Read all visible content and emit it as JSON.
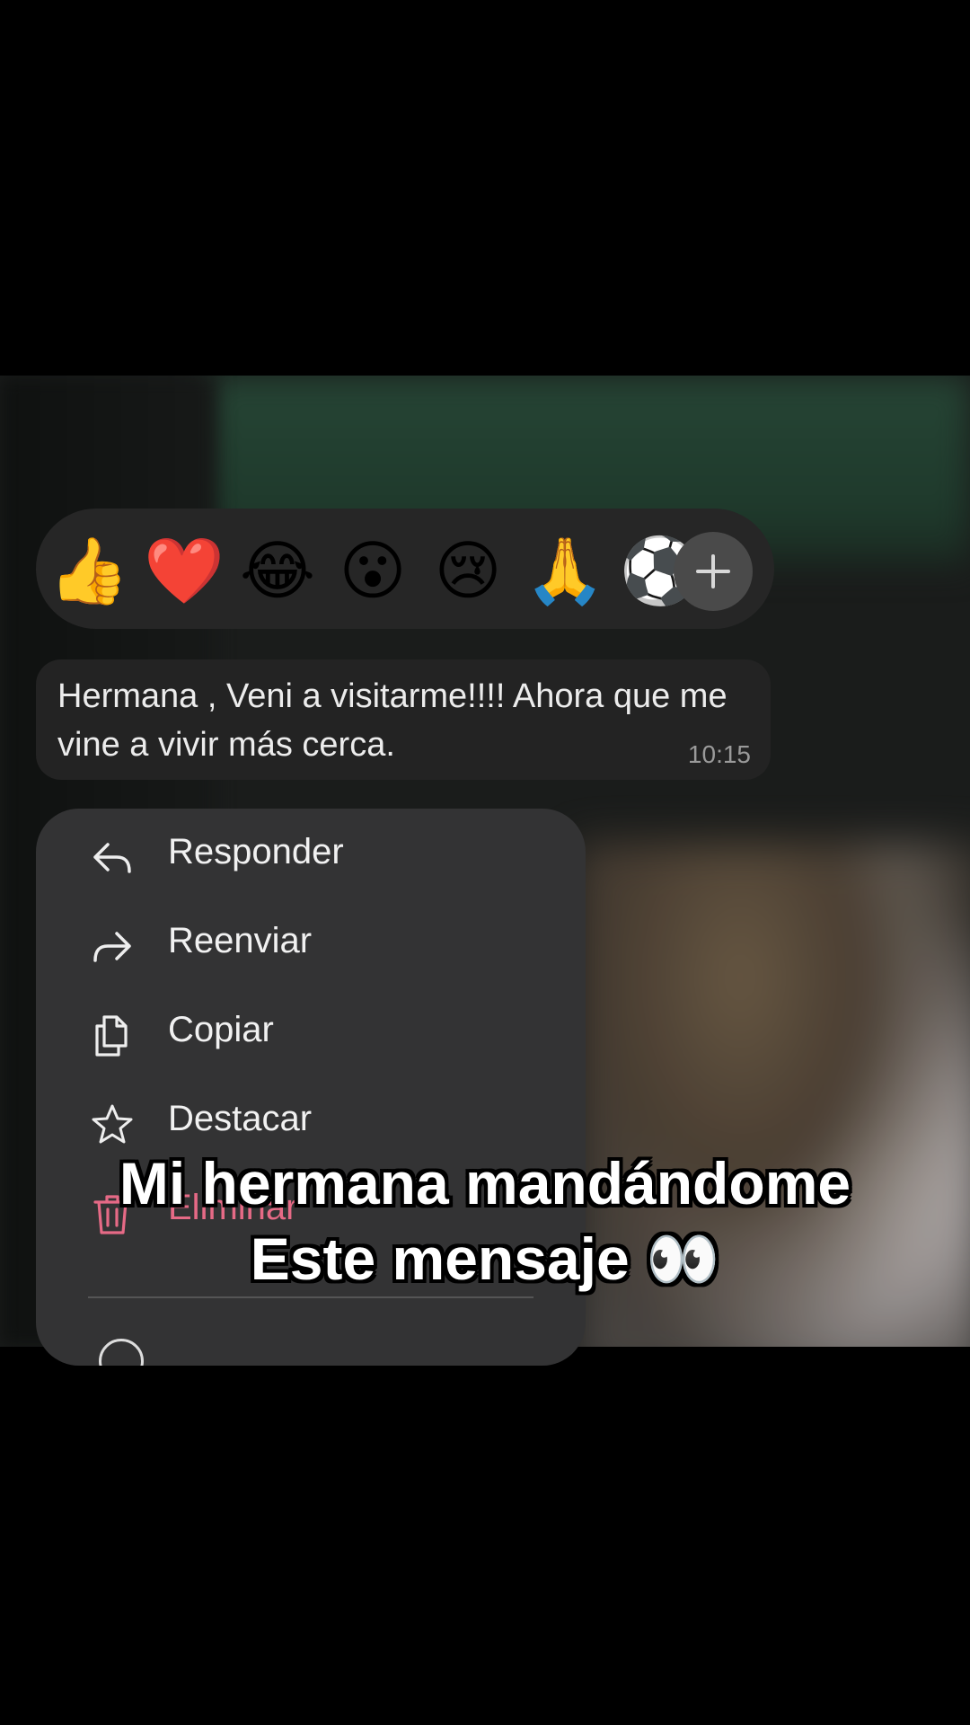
{
  "reactions": {
    "items": [
      {
        "emoji": "👍",
        "name": "thumbs-up"
      },
      {
        "emoji": "❤️",
        "name": "heart"
      },
      {
        "emoji": "😂",
        "name": "tears-of-joy"
      },
      {
        "emoji": "😮",
        "name": "surprised"
      },
      {
        "emoji": "😢",
        "name": "crying"
      },
      {
        "emoji": "🙏",
        "name": "praying-hands"
      },
      {
        "emoji": "⚽",
        "name": "soccer-ball"
      }
    ],
    "more_icon": "plus-icon"
  },
  "message": {
    "text": "Hermana , Veni a visitarme!!!! Ahora que me vine a vivir más cerca.",
    "time": "10:15"
  },
  "menu": {
    "items": [
      {
        "label": "Responder",
        "icon": "reply-icon"
      },
      {
        "label": "Reenviar",
        "icon": "forward-icon"
      },
      {
        "label": "Copiar",
        "icon": "copy-icon"
      },
      {
        "label": "Destacar",
        "icon": "star-icon"
      },
      {
        "label": "Eliminar",
        "icon": "trash-icon",
        "color": "#e66a86"
      }
    ]
  },
  "caption": {
    "line1": "Mi hermana mandándome",
    "line2": "Este mensaje",
    "emoji": "👀"
  }
}
